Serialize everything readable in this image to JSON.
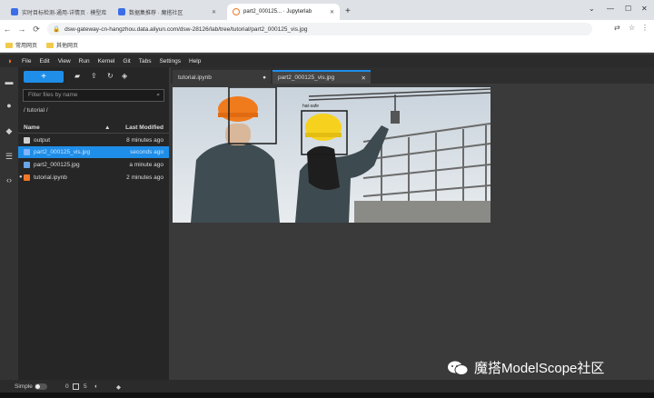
{
  "browser": {
    "tabs": [
      {
        "label": "实时目标检测-通用-详情页 · 模型库"
      },
      {
        "label": "数据集推荐 · 魔搭社区"
      },
      {
        "label": "part2_000125... · Jupyterlab"
      }
    ],
    "url": "dsw-gateway-cn-hangzhou.data.aliyun.com/dsw-28126/lab/tree/tutorial/part2_000125_vis.jpg",
    "bookmarks": [
      {
        "label": "常用网页"
      },
      {
        "label": "其他网页"
      }
    ]
  },
  "jupyter": {
    "menu": [
      "File",
      "Edit",
      "View",
      "Run",
      "Kernel",
      "Git",
      "Tabs",
      "Settings",
      "Help"
    ],
    "new_button": "+",
    "filter_placeholder": "Filter files by name",
    "breadcrumb": "/ tutorial /",
    "columns": {
      "name": "Name",
      "modified": "Last Modified",
      "sort": "▲"
    },
    "files": [
      {
        "name": "output",
        "modified": "8 minutes ago",
        "type": "folder"
      },
      {
        "name": "part2_000125_vis.jpg",
        "modified": "seconds ago",
        "type": "image",
        "selected": true
      },
      {
        "name": "part2_000125.jpg",
        "modified": "a minute ago",
        "type": "image"
      },
      {
        "name": "tutorial.ipynb",
        "modified": "2 minutes ago",
        "type": "notebook",
        "running": true
      }
    ],
    "doc_tabs": [
      {
        "label": "tutorial.ipynb",
        "close": "●"
      },
      {
        "label": "part2_000125_vis.jpg",
        "close": "✕"
      }
    ],
    "detection_label": "hat-safe",
    "status": {
      "mode": "Simple",
      "a": "0",
      "b": "5"
    }
  },
  "watermark": {
    "text": "魔搭ModelScope社区"
  },
  "colors": {
    "accent": "#1f8ee8",
    "jupyter_orange": "#f37726"
  }
}
